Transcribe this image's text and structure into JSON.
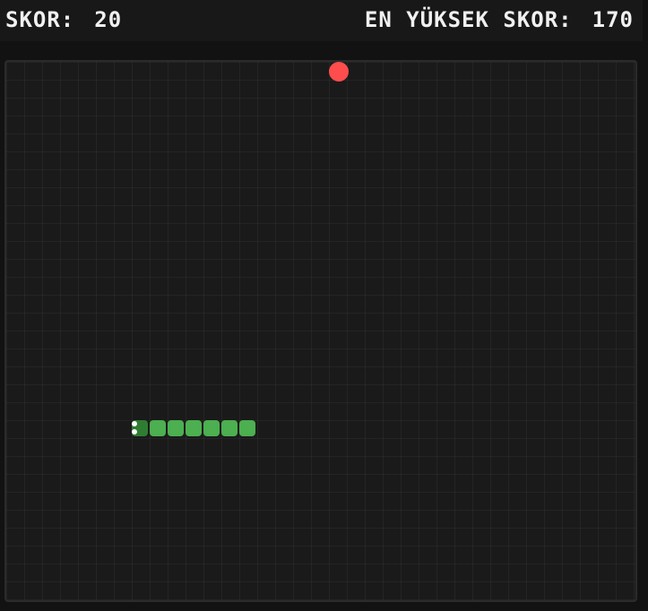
{
  "scoreboard": {
    "score_label": "SKOR:",
    "score_value": "20",
    "high_score_label": "EN YÜKSEK SKOR:",
    "high_score_value": "170"
  },
  "game": {
    "direction": "left",
    "snake_length": 7,
    "colors": {
      "background": "#121212",
      "board": "#1a1a1a",
      "snake_head": "#2e7d32",
      "snake_body": "#4caf50",
      "food": "#ff4d4d",
      "text": "#f0f0f0"
    },
    "icons": {
      "food": "food-dot",
      "snake_eyes": "snake-eye"
    }
  }
}
